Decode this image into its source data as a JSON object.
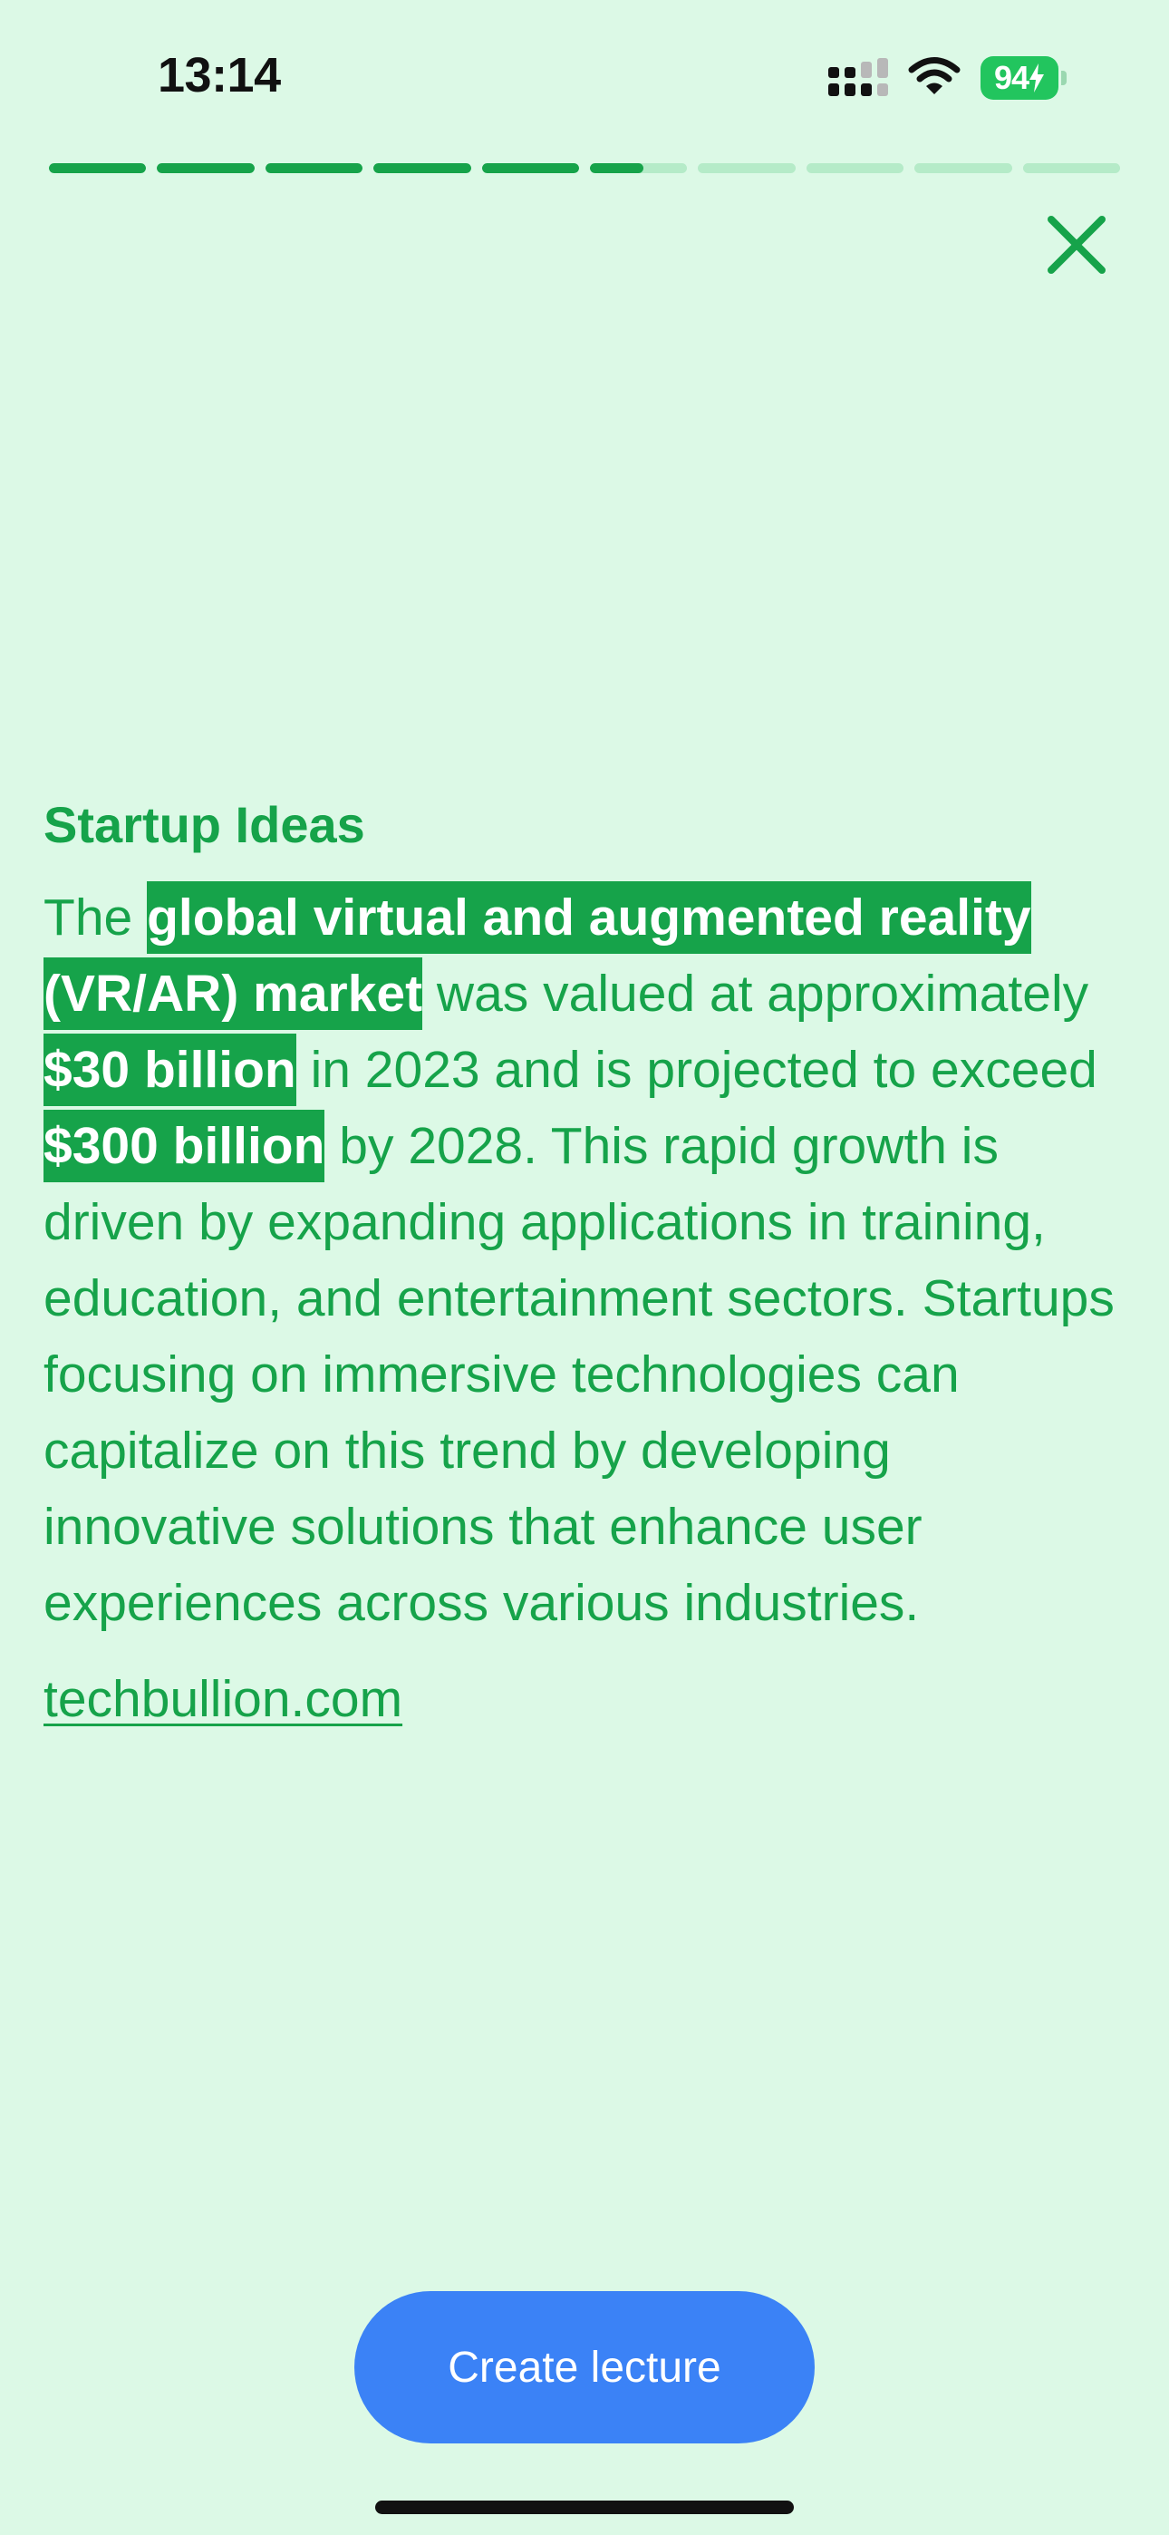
{
  "status_bar": {
    "time": "13:14",
    "battery_level": "94",
    "icons": [
      "signal-icon",
      "wifi-icon",
      "battery-charging-icon"
    ]
  },
  "progress": {
    "total_segments": 10,
    "completed_segments": 5,
    "current_segment_fraction": 0.55
  },
  "close_icon": "close-icon",
  "card": {
    "title": "Startup Ideas",
    "segments": [
      {
        "text": "The ",
        "highlight": false
      },
      {
        "text": "global virtual and augmented reality (VR/AR) market",
        "highlight": true
      },
      {
        "text": " was valued at approximately ",
        "highlight": false
      },
      {
        "text": "$30 billion",
        "highlight": true
      },
      {
        "text": " in 2023 and is projected to exceed ",
        "highlight": false
      },
      {
        "text": "$300 billion",
        "highlight": true
      },
      {
        "text": " by 2028. This rapid growth is driven by expanding applications in training, education, and entertainment sectors. Startups focusing on immersive technologies can capitalize on this trend by developing innovative solutions that enhance user experiences across various industries.",
        "highlight": false
      }
    ],
    "source": "techbullion.com"
  },
  "cta": {
    "label": "Create lecture"
  },
  "colors": {
    "background": "#dcf9e6",
    "accent": "#16a34a",
    "progress_inactive": "#b5ebc8",
    "button": "#3b82f6"
  }
}
